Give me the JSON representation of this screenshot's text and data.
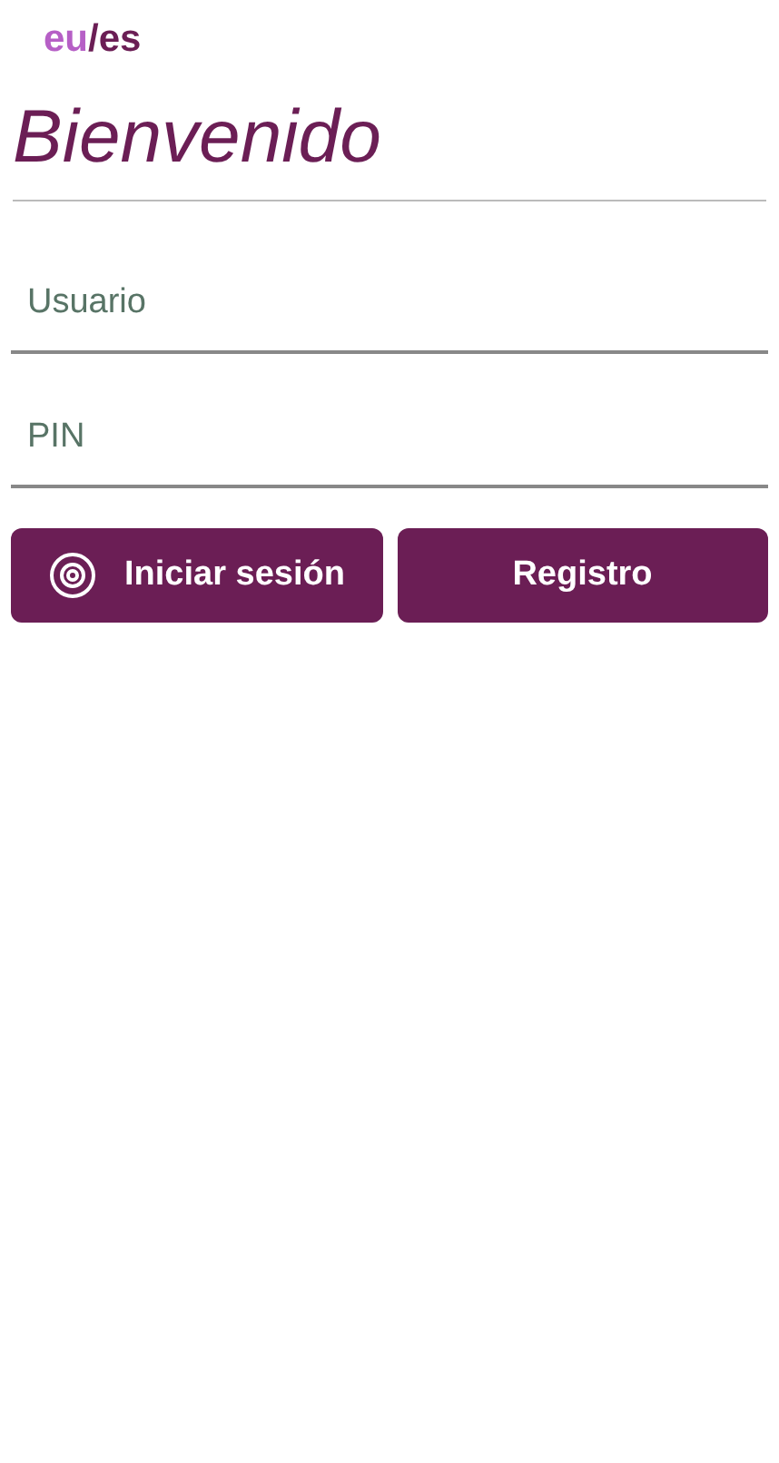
{
  "language_switch": {
    "separator": "/",
    "languages": [
      {
        "label": "eu",
        "selected": false
      },
      {
        "label": "es",
        "selected": true
      }
    ]
  },
  "title": "Bienvenido",
  "fields": [
    {
      "placeholder": "Usuario"
    },
    {
      "placeholder": "PIN"
    }
  ],
  "buttons": [
    {
      "label": "Iniciar sesión",
      "kind": "icon"
    },
    {
      "label": "Registro",
      "kind": "plain"
    }
  ]
}
